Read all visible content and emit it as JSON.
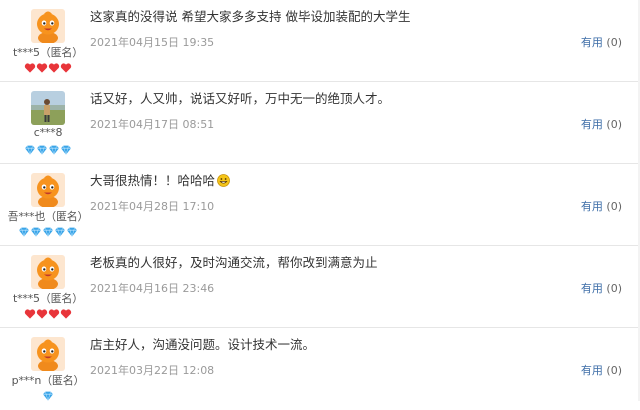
{
  "reviews": [
    {
      "username": "t***5（匿名）",
      "avatar": "orange-mascot",
      "level_icon": "heart",
      "level_count": 4,
      "level_color": "#e8353a",
      "content": "这家真的没得说 希望大家多多支持 做毕设加装配的大学生",
      "date": "2021年04月15日 19:35",
      "useful_label": "有用",
      "useful_count": "(0)"
    },
    {
      "username": "c***8",
      "avatar": "photo",
      "level_icon": "diamond",
      "level_count": 4,
      "level_color": "#3aa5e8",
      "content": "话又好，人又帅，说话又好听，万中无一的绝顶人才。",
      "date": "2021年04月17日 08:51",
      "useful_label": "有用",
      "useful_count": "(0)"
    },
    {
      "username": "吾***也（匿名）",
      "avatar": "orange-mascot",
      "level_icon": "diamond",
      "level_count": 5,
      "level_color": "#3aa5e8",
      "content": "大哥很热情！！哈哈哈",
      "emoji": "grinning-face",
      "date": "2021年04月28日 17:10",
      "useful_label": "有用",
      "useful_count": "(0)"
    },
    {
      "username": "t***5（匿名）",
      "avatar": "orange-mascot",
      "level_icon": "heart",
      "level_count": 4,
      "level_color": "#e8353a",
      "content": "老板真的人很好，及时沟通交流，帮你改到满意为止",
      "date": "2021年04月16日 23:46",
      "useful_label": "有用",
      "useful_count": "(0)"
    },
    {
      "username": "p***n（匿名）",
      "avatar": "orange-mascot",
      "level_icon": "diamond",
      "level_count": 1,
      "level_color": "#3aa5e8",
      "content": "店主好人，沟通没问题。设计技术一流。",
      "date": "2021年03月22日 12:08",
      "useful_label": "有用",
      "useful_count": "(0)"
    }
  ]
}
